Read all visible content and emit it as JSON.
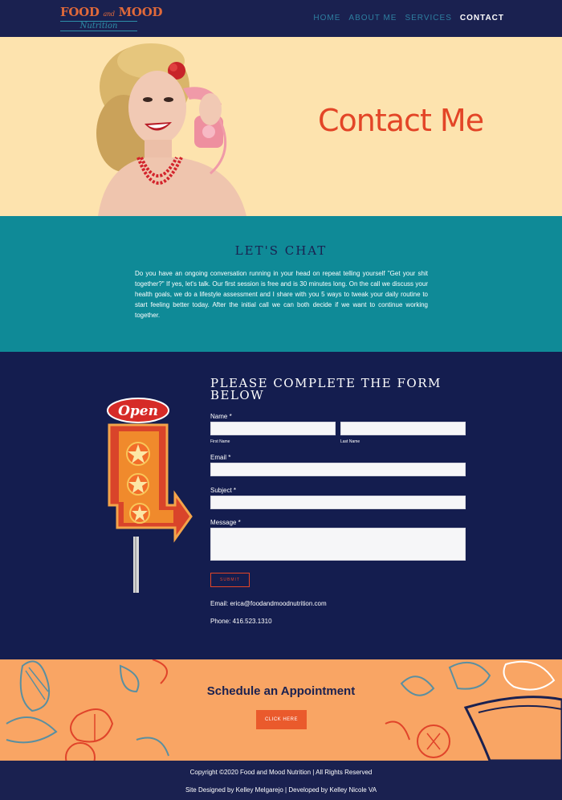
{
  "logo": {
    "line1_a": "FOOD",
    "line1_and": "and",
    "line1_b": "MOOD",
    "line2": "Nutrition"
  },
  "nav": {
    "items": [
      {
        "label": "HOME"
      },
      {
        "label": "ABOUT ME"
      },
      {
        "label": "SERVICES"
      },
      {
        "label": "CONTACT"
      }
    ]
  },
  "hero": {
    "title": "Contact Me"
  },
  "chat": {
    "title": "LET'S CHAT",
    "body": "Do you have an ongoing conversation running in your head on repeat telling yourself \"Get your shit together?\" If yes, let's talk. Our first session is free and is 30 minutes long. On the call we discuss your health goals, we do a lifestyle assessment and I share with you 5 ways to tweak your daily routine to start feeling better today. After the initial call we can both decide if we want to continue working together."
  },
  "form": {
    "title": "PLEASE COMPLETE THE FORM BELOW",
    "name_label": "Name *",
    "first_name_label": "First Name",
    "last_name_label": "Last Name",
    "email_label": "Email *",
    "subject_label": "Subject *",
    "message_label": "Message *",
    "submit_label": "SUBMIT",
    "sign_text": "Open"
  },
  "contact": {
    "email": "Email: erica@foodandmoodnutrition.com",
    "phone": "Phone: 416.523.1310"
  },
  "appointment": {
    "title": "Schedule an Appointment",
    "button_label": "CLICK HERE"
  },
  "footer": {
    "copyright": "Copyright ©2020 Food and Mood Nutrition | All Rights Reserved",
    "credits": "Site Designed by Kelley Melgarejo | Developed by Kelley Nicole VA"
  },
  "colors": {
    "navy": "#1a2150",
    "cream": "#fde3ae",
    "teal": "#0f8a97",
    "accent": "#e34527",
    "orange": "#f9a564",
    "button": "#ea5a2c"
  }
}
